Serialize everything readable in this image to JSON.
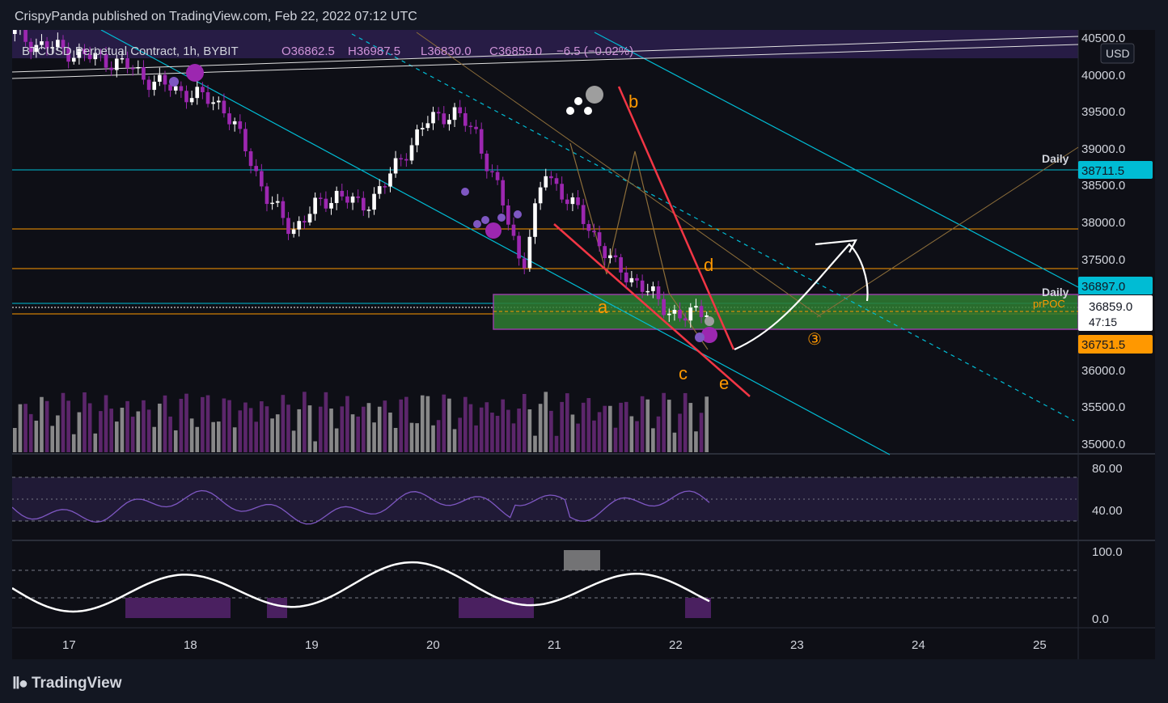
{
  "header": {
    "publisher": "CrispyPanda published on TradingView.com, Feb 22, 2022 07:12 UTC"
  },
  "legend": {
    "symbol": "BTCUSD Perpetual Contract, 1h, BYBIT",
    "open": "O36862.5",
    "high": "H36987.5",
    "low": "L36830.0",
    "close": "C36859.0",
    "change": "−6.5 (−0.02%)"
  },
  "currency": "USD",
  "price_axis": {
    "ticks": [
      "40500.0",
      "40000.0",
      "39500.0",
      "39000.0",
      "38500.0",
      "38000.0",
      "37500.0",
      "36000.0",
      "35500.0",
      "35000.0"
    ],
    "tags": {
      "daily_upper_price": "38711.5",
      "daily_upper_label": "Daily",
      "daily_lower_price": "36897.0",
      "daily_lower_label": "Daily",
      "prpoc_label": "prPOC",
      "last_price": "36859.0",
      "countdown": "47:15",
      "low_tag": "36751.5"
    }
  },
  "rsi_axis": {
    "ticks": [
      "80.00",
      "40.00"
    ]
  },
  "stoch_axis": {
    "ticks": [
      "100.0",
      "0.0"
    ]
  },
  "time_axis": {
    "ticks": [
      "17",
      "18",
      "19",
      "20",
      "21",
      "22",
      "23",
      "24",
      "25"
    ]
  },
  "annotations": {
    "a": "a",
    "b": "b",
    "c": "c",
    "d": "d",
    "e": "e",
    "wave3": "③"
  },
  "colors": {
    "background": "#0e0f16",
    "up_candle": "#ffffff",
    "down_candle": "#9c27b0",
    "channel": "#00bcd4",
    "wedge": "#f23645",
    "orange_text": "#ff9800",
    "zone": "#2e7d32"
  },
  "footer": {
    "brand": "TradingView"
  },
  "chart_data": {
    "type": "candlestick",
    "x_ticks": [
      "17",
      "18",
      "19",
      "20",
      "21",
      "22",
      "23",
      "24",
      "25"
    ],
    "ylim": [
      34900,
      40550
    ],
    "series": [
      {
        "name": "BTCUSD",
        "values": [
          40550,
          40400,
          40350,
          40250,
          40200,
          40100,
          39900,
          39800,
          39700,
          39600,
          39000,
          38300,
          37900,
          38200,
          38400,
          38200,
          38500,
          39000,
          39400,
          39500,
          39200,
          38400,
          37400,
          38700,
          38300,
          37900,
          37400,
          37200,
          36900,
          36700,
          36859
        ]
      }
    ],
    "levels": [
      38711.5,
      37920,
      37430,
      36897.0,
      36859.0
    ]
  }
}
